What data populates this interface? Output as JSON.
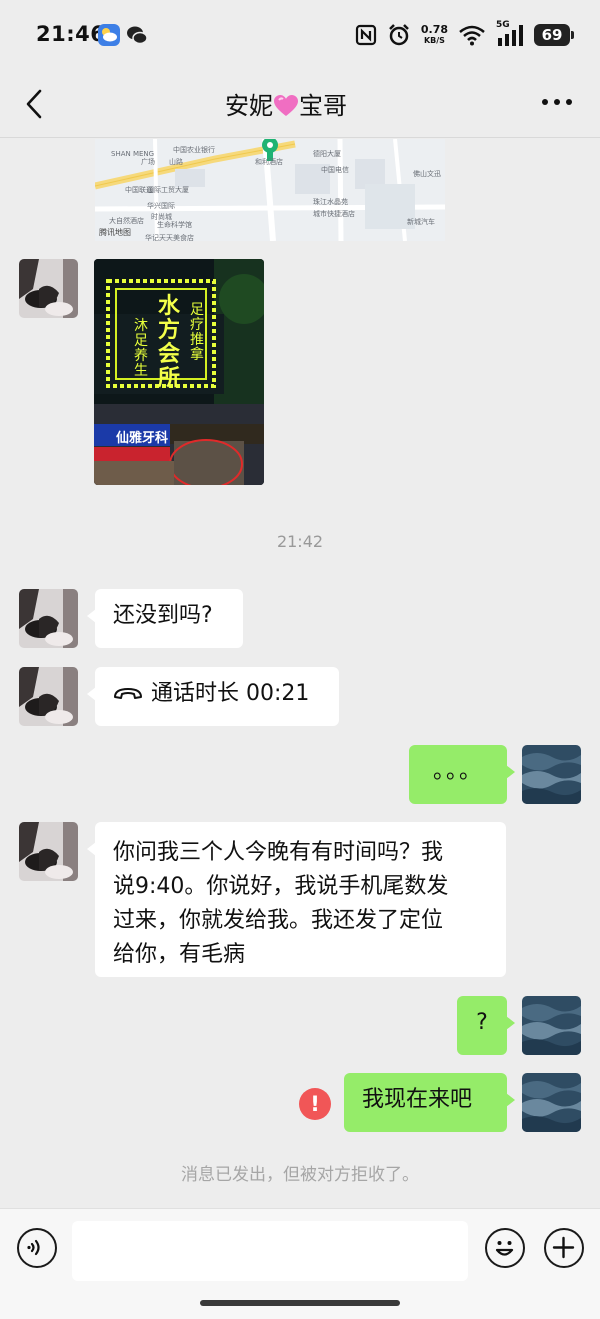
{
  "status_bar": {
    "time": "21:46",
    "net_speed": "0.78",
    "net_unit": "KB/S",
    "signal_label": "5G",
    "battery": "69"
  },
  "header": {
    "title_left": "安妮",
    "title_right": "宝哥",
    "back_icon": "chevron-left-icon",
    "more_icon": "more-dots-icon"
  },
  "map": {
    "labels": [
      "中国农业银行",
      "SHAN MENG",
      "广场",
      "山路",
      "中国联通",
      "国际工贸大厦",
      "华兴国际",
      "时尚城",
      "大自然酒店",
      "生命科学馆",
      "珠江水晶苑",
      "和利酒店",
      "德阳大厦",
      "中国电信",
      "华记天天美食店",
      "城市快捷酒店",
      "新城汽车",
      "佛山文迅"
    ],
    "credit": "腾讯地图"
  },
  "photo": {
    "sign_lines": [
      "水方会所",
      "沐足 养生",
      "足疗 推拿"
    ],
    "shop_sign": "仙雅牙科"
  },
  "timestamp": "21:42",
  "messages": [
    {
      "side": "left",
      "text": "还没到吗?"
    },
    {
      "side": "left",
      "type": "call",
      "text": "通话时长 00:21"
    },
    {
      "side": "right",
      "text": "。。。"
    },
    {
      "side": "left",
      "lines": [
        "你问我三个人今晚有有时间吗？我",
        "说9:40。你说好，我说手机尾数发",
        "过来，你就发给我。我还发了定位",
        "给你，有毛病"
      ]
    },
    {
      "side": "right",
      "text": "?"
    },
    {
      "side": "right",
      "text": "我现在来吧",
      "status": "failed"
    }
  ],
  "error_badge": "!",
  "system_note": "消息已发出，但被对方拒收了。",
  "input": {
    "voice_icon": "voice-icon",
    "emoji_icon": "emoji-icon",
    "plus_icon": "plus-icon",
    "placeholder": ""
  },
  "colors": {
    "background": "#ededed",
    "sent_bubble": "#95ec69",
    "received_bubble": "#ffffff",
    "error": "#f15657"
  }
}
